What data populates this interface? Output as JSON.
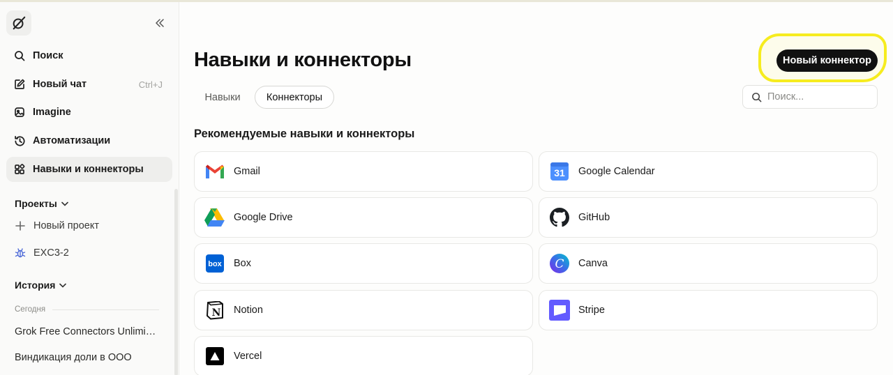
{
  "sidebar": {
    "nav": [
      {
        "label": "Поиск",
        "icon": "search-icon"
      },
      {
        "label": "Новый чат",
        "icon": "edit-icon",
        "shortcut": "Ctrl+J"
      },
      {
        "label": "Imagine",
        "icon": "image-icon"
      },
      {
        "label": "Автоматизации",
        "icon": "history-clock-icon"
      },
      {
        "label": "Навыки и коннекторы",
        "icon": "widgets-icon",
        "active": true
      }
    ],
    "projects": {
      "title": "Проекты",
      "new_project": "Новый проект",
      "items": [
        {
          "label": "EXC3-2",
          "icon": "bug-icon",
          "color": "#4f6bd8"
        }
      ]
    },
    "history": {
      "title": "История",
      "group": "Сегодня",
      "items": [
        "Grok Free Connectors Unlimited",
        "Виндикация доли в ООО"
      ]
    }
  },
  "main": {
    "title": "Навыки и коннекторы",
    "new_connector": "Новый коннектор",
    "tabs": [
      {
        "label": "Навыки",
        "active": false
      },
      {
        "label": "Коннекторы",
        "active": true
      }
    ],
    "search_placeholder": "Поиск...",
    "section_title": "Рекомендуемые навыки и коннекторы",
    "connectors": [
      {
        "name": "Gmail",
        "icon": "gmail-icon"
      },
      {
        "name": "Google Calendar",
        "icon": "google-calendar-icon",
        "badge": "31"
      },
      {
        "name": "Google Drive",
        "icon": "google-drive-icon"
      },
      {
        "name": "GitHub",
        "icon": "github-icon"
      },
      {
        "name": "Box",
        "icon": "box-icon",
        "badge": "box"
      },
      {
        "name": "Canva",
        "icon": "canva-icon",
        "badge": "C"
      },
      {
        "name": "Notion",
        "icon": "notion-icon",
        "badge": "N"
      },
      {
        "name": "Stripe",
        "icon": "stripe-icon"
      },
      {
        "name": "Vercel",
        "icon": "vercel-icon"
      }
    ]
  },
  "colors": {
    "accent_highlight": "#f6ec1f",
    "button_bg": "#111111",
    "sidebar_active": "#eeeeec"
  }
}
